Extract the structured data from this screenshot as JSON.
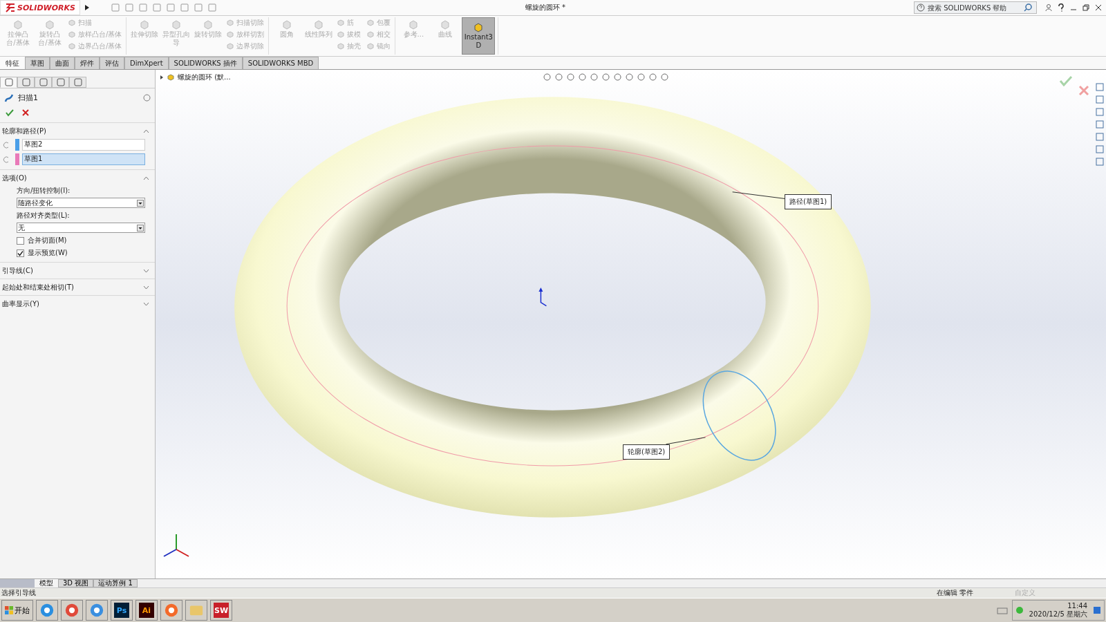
{
  "window": {
    "app_name": "SOLIDWORKS",
    "title": "螺旋的圆环 *",
    "search": {
      "placeholder": "搜索 SOLIDWORKS 帮助"
    }
  },
  "ribbon": {
    "groups": [
      {
        "items": [
          {
            "kind": "large",
            "label": "拉伸凸台/基体",
            "disabled": true,
            "selected": false
          },
          {
            "kind": "large",
            "label": "旋转凸台/基体",
            "disabled": true,
            "selected": false
          },
          {
            "kind": "small",
            "label": "扫描",
            "disabled": true,
            "selected": false
          },
          {
            "kind": "small",
            "label": "放样凸台/基体",
            "disabled": true,
            "selected": false
          },
          {
            "kind": "small",
            "label": "边界凸台/基体",
            "disabled": true,
            "selected": false
          }
        ]
      },
      {
        "items": [
          {
            "kind": "large",
            "label": "拉伸切除",
            "disabled": true,
            "selected": false
          },
          {
            "kind": "large",
            "label": "异型孔向导",
            "disabled": true,
            "selected": false
          },
          {
            "kind": "large",
            "label": "旋转切除",
            "disabled": true,
            "selected": false
          },
          {
            "kind": "small",
            "label": "扫描切除",
            "disabled": true,
            "selected": false
          },
          {
            "kind": "small",
            "label": "放样切割",
            "disabled": true,
            "selected": false
          },
          {
            "kind": "small",
            "label": "边界切除",
            "disabled": true,
            "selected": false
          }
        ]
      },
      {
        "items": [
          {
            "kind": "large",
            "label": "圆角",
            "disabled": true,
            "selected": false
          },
          {
            "kind": "large",
            "label": "线性阵列",
            "disabled": true,
            "selected": false
          },
          {
            "kind": "small",
            "label": "筋",
            "disabled": true,
            "selected": false
          },
          {
            "kind": "small",
            "label": "拔模",
            "disabled": true,
            "selected": false
          },
          {
            "kind": "small",
            "label": "抽壳",
            "disabled": true,
            "selected": false
          },
          {
            "kind": "small",
            "label": "包覆",
            "disabled": true,
            "selected": false
          },
          {
            "kind": "small",
            "label": "相交",
            "disabled": true,
            "selected": false
          },
          {
            "kind": "small",
            "label": "镜向",
            "disabled": true,
            "selected": false
          }
        ]
      },
      {
        "items": [
          {
            "kind": "large",
            "label": "参考...",
            "disabled": true,
            "selected": false
          },
          {
            "kind": "large",
            "label": "曲线",
            "disabled": true,
            "selected": false
          },
          {
            "kind": "large",
            "label": "Instant3D",
            "disabled": false,
            "selected": true
          }
        ]
      }
    ]
  },
  "tabs": [
    {
      "label": "特征",
      "selected": true
    },
    {
      "label": "草图",
      "selected": false
    },
    {
      "label": "曲面",
      "selected": false
    },
    {
      "label": "焊件",
      "selected": false
    },
    {
      "label": "评估",
      "selected": false
    },
    {
      "label": "DimXpert",
      "selected": false
    },
    {
      "label": "SOLIDWORKS 插件",
      "selected": false
    },
    {
      "label": "SOLIDWORKS MBD",
      "selected": false
    }
  ],
  "property_manager": {
    "panel_tabs": [
      {
        "selected": true
      },
      {
        "selected": false
      },
      {
        "selected": false
      },
      {
        "selected": false
      },
      {
        "selected": false
      }
    ],
    "title": "扫描1",
    "sections": [
      {
        "title": "轮廓和路径(P)",
        "expanded": true,
        "selections": [
          {
            "value": "草图2",
            "color": "#4a9ee8",
            "selected": false
          },
          {
            "value": "草图1",
            "color": "#e97ab9",
            "selected": true
          }
        ]
      },
      {
        "title": "选项(O)",
        "expanded": true,
        "dropdowns": [
          {
            "label": "方向/扭转控制(I):",
            "value": "随路径变化"
          },
          {
            "label": "路径对齐类型(L):",
            "value": "无"
          }
        ],
        "checkboxes": [
          {
            "label": "合并切面(M)",
            "checked": false
          },
          {
            "label": "显示预览(W)",
            "checked": true
          }
        ]
      },
      {
        "title": "引导线(C)",
        "expanded": false
      },
      {
        "title": "起始处和结束处相切(T)",
        "expanded": false
      },
      {
        "title": "曲率显示(Y)",
        "expanded": false
      }
    ]
  },
  "viewport": {
    "tree_item": "螺旋的圆环 (默...",
    "callouts": [
      {
        "kind": "path",
        "label": "路径(草图1)"
      },
      {
        "kind": "profile",
        "label": "轮廓(草图2)"
      }
    ]
  },
  "bottom_tabs": [
    {
      "label": "模型",
      "selected": true
    },
    {
      "label": "3D 视图",
      "selected": false
    },
    {
      "label": "运动算例 1",
      "selected": false
    }
  ],
  "status_bar": {
    "message": "选择引导线",
    "mode": "在编辑 零件",
    "units": "自定义"
  },
  "taskbar": {
    "start": "开始",
    "apps": [
      {
        "kind": "browser"
      },
      {
        "kind": "chrome"
      },
      {
        "kind": "cloud"
      },
      {
        "kind": "ps",
        "label": "Ps"
      },
      {
        "kind": "ai",
        "label": "Ai"
      },
      {
        "kind": "firefox"
      },
      {
        "kind": "folder"
      },
      {
        "kind": "sw",
        "label": "SW"
      }
    ],
    "time": "11:44",
    "date": "2020/12/5 星期六"
  }
}
